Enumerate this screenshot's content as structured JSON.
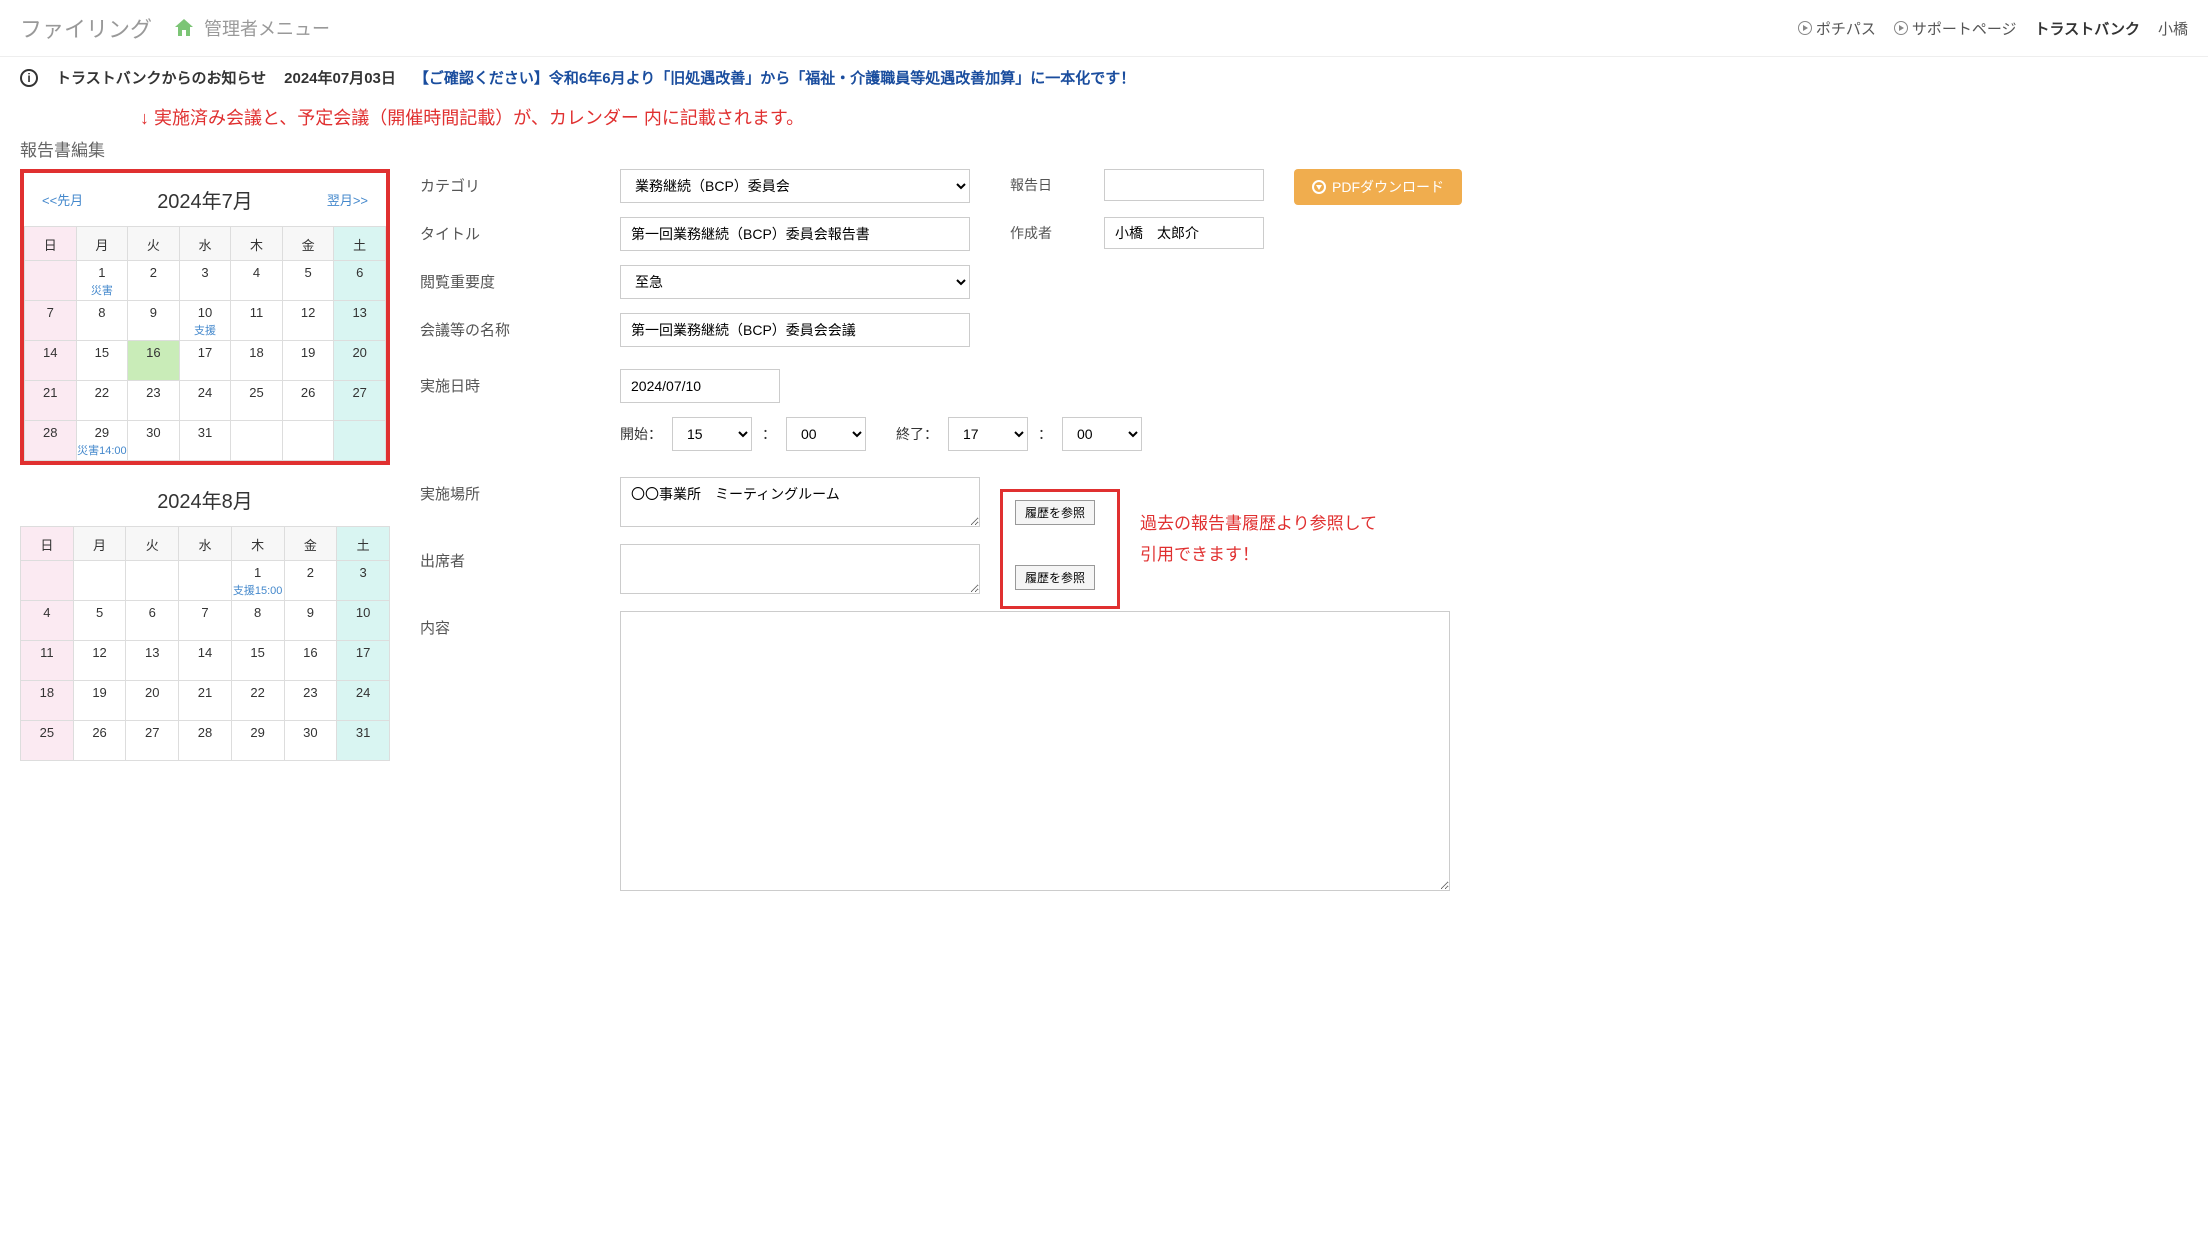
{
  "header": {
    "title": "ファイリング",
    "menu": "管理者メニュー",
    "links": {
      "a": "ポチパス",
      "b": "サポートページ",
      "brand": "トラストバンク",
      "user": "小橋"
    }
  },
  "notice": {
    "label": "トラストバンクからのお知らせ",
    "date": "2024年07月03日",
    "text": "【ご確認ください】令和6年6月より「旧処遇改善」から「福祉・介護職員等処遇改善加算」に一本化です！"
  },
  "annot_top": "↓ 実施済み会議と、予定会議（開催時間記載）が、カレンダー 内に記載されます。",
  "page_title": "報告書編集",
  "cal1": {
    "month": "2024年7月",
    "prev": "<<先月",
    "next": "翌月>>",
    "dow": [
      "日",
      "月",
      "火",
      "水",
      "木",
      "金",
      "土"
    ],
    "ev1": "災害",
    "ev10": "支援",
    "ev29": "災害14:00"
  },
  "cal2": {
    "month": "2024年8月",
    "dow": [
      "日",
      "月",
      "火",
      "水",
      "木",
      "金",
      "土"
    ],
    "ev1": "支援15:00"
  },
  "form": {
    "labels": {
      "category": "カテゴリ",
      "title": "タイトル",
      "importance": "閲覧重要度",
      "meeting": "会議等の名称",
      "datetime": "実施日時",
      "start": "開始：",
      "end": "終了：",
      "place": "実施場所",
      "attendee": "出席者",
      "content": "内容",
      "report_date": "報告日",
      "author": "作成者"
    },
    "values": {
      "category": "業務継続（BCP）委員会",
      "title": "第一回業務継続（BCP）委員会報告書",
      "importance": "至急",
      "meeting": "第一回業務継続（BCP）委員会会議",
      "date": "2024/07/10",
      "sh": "15",
      "sm": "00",
      "eh": "17",
      "em": "00",
      "place": "〇〇事業所　ミーティングルーム",
      "author": "小橋　太郎介"
    },
    "hist_btn": "履歴を参照",
    "pdf_btn": "PDFダウンロード"
  },
  "annot_side": {
    "l1": "過去の報告書履歴より参照して",
    "l2": "引用できます！"
  }
}
